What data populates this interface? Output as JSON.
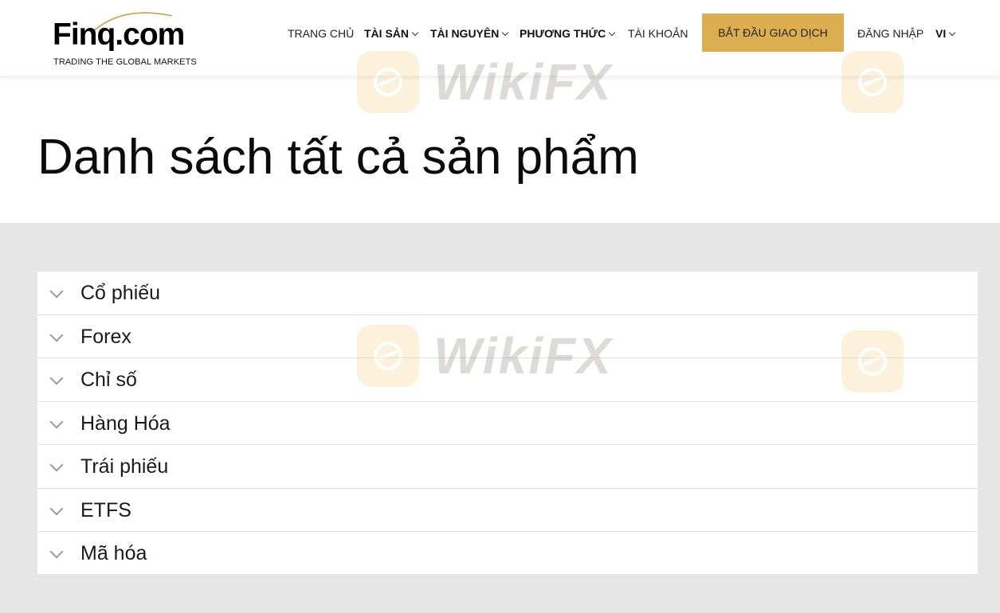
{
  "header": {
    "logo_text": "Finq.com",
    "logo_tagline": "TRADING THE GLOBAL MARKETS",
    "nav": [
      {
        "label": "TRANG CHỦ",
        "dropdown": false
      },
      {
        "label": "TÀI SẢN",
        "dropdown": true
      },
      {
        "label": "TÀI NGUYÊN",
        "dropdown": true
      },
      {
        "label": "PHƯƠNG THỨC",
        "dropdown": true
      },
      {
        "label": "TÀI KHOẢN",
        "dropdown": false
      }
    ],
    "cta_label": "BẮT ĐẦU GIAO DỊCH",
    "login_label": "ĐĂNG NHẬP",
    "language_label": "VI"
  },
  "main": {
    "title": "Danh sách tất cả sản phẩm",
    "categories": [
      {
        "label": "Cổ phiếu"
      },
      {
        "label": "Forex"
      },
      {
        "label": "Chỉ số"
      },
      {
        "label": "Hàng Hóa"
      },
      {
        "label": "Trái phiếu"
      },
      {
        "label": "ETFS"
      },
      {
        "label": "Mã hóa"
      }
    ]
  },
  "watermark": {
    "text": "WikiFX"
  },
  "colors": {
    "accent": "#dcae4f",
    "section_background": "#e6e6e6",
    "chevron": "#9a9a9a"
  },
  "icons": {
    "accordion_toggle": "chevron-down-icon",
    "nav_dropdown": "chevron-down-icon"
  }
}
